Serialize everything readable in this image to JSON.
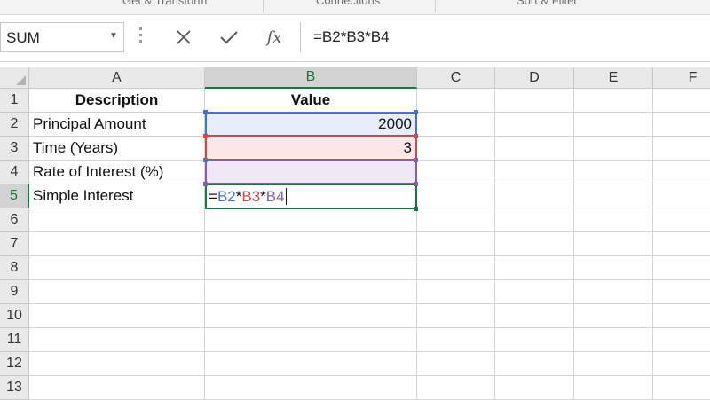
{
  "ribbon": {
    "groups": [
      "Get & Transform",
      "Connections",
      "Sort & Filter"
    ]
  },
  "formula_bar": {
    "name_box": "SUM",
    "cancel_icon": "close-icon",
    "enter_icon": "checkmark-icon",
    "fx_label": "fx",
    "formula": "=B2*B3*B4"
  },
  "columns": [
    "A",
    "B",
    "C",
    "D",
    "E",
    "F"
  ],
  "active_column": "B",
  "rows": [
    "1",
    "2",
    "3",
    "4",
    "5",
    "6",
    "7",
    "8",
    "9",
    "10",
    "11",
    "12",
    "13"
  ],
  "active_row": "5",
  "cells": {
    "A1": "Description",
    "B1": "Value",
    "A2": "Principal Amount",
    "B2": "2000",
    "A3": "Time (Years)",
    "B3": "3",
    "A4": "Rate of Interest (%)",
    "B4": "",
    "A5": "Simple Interest"
  },
  "editing_formula": {
    "prefix": "=",
    "ref1": "B2",
    "op1": "*",
    "ref2": "B3",
    "op2": "*",
    "ref3": "B4"
  },
  "colors": {
    "ref_b2": "#4472c4",
    "ref_b3": "#c0504d",
    "ref_b4": "#8064a2",
    "selection": "#217346"
  }
}
